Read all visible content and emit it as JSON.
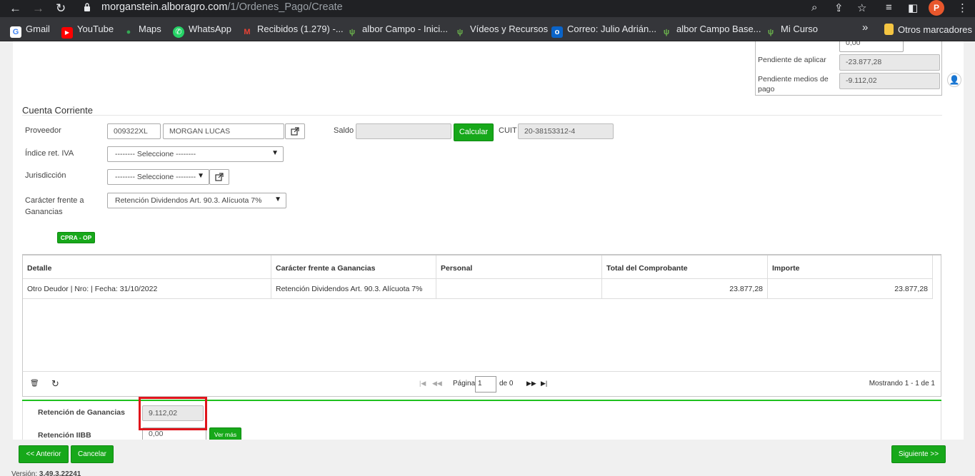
{
  "browser": {
    "url_host": "morganstein.alboragro.com",
    "url_path": "/1/Ordenes_Pago/Create",
    "profile_initial": "P",
    "bookmarks": [
      {
        "label": "Gmail",
        "icon": "G",
        "color": "#4285f4"
      },
      {
        "label": "YouTube",
        "icon": "▶",
        "color": "#ff0000"
      },
      {
        "label": "Maps",
        "icon": "●",
        "color": "#34a853"
      },
      {
        "label": "WhatsApp",
        "icon": "✆",
        "color": "#25d366"
      },
      {
        "label": "Recibidos (1.279) -...",
        "icon": "M",
        "color": "#ea4335"
      },
      {
        "label": "albor Campo - Inici...",
        "icon": "ψ",
        "color": "#6ab04c"
      },
      {
        "label": "Vídeos y Recursos",
        "icon": "ψ",
        "color": "#6ab04c"
      },
      {
        "label": "Correo: Julio Adrián...",
        "icon": "o",
        "color": "#0a64c9"
      },
      {
        "label": "albor Campo Base...",
        "icon": "ψ",
        "color": "#6ab04c"
      },
      {
        "label": "Mi Curso",
        "icon": "ψ",
        "color": "#6ab04c"
      }
    ],
    "more_bookmarks": "»",
    "other_bookmarks": "Otros marcadores"
  },
  "summary": {
    "partial_value": "0,00",
    "pendiente_aplicar_label": "Pendiente de aplicar",
    "pendiente_aplicar_value": "-23.877,28",
    "pendiente_medios_label": "Pendiente medios de pago",
    "pendiente_medios_value": "-9.112,02"
  },
  "form": {
    "section_title": "Cuenta Corriente",
    "proveedor_label": "Proveedor",
    "proveedor_code": "009322XL",
    "proveedor_name": "MORGAN LUCAS",
    "saldo_label": "Saldo",
    "saldo_value": "",
    "calcular_label": "Calcular",
    "cuit_label": "CUIT",
    "cuit_value": "20-38153312-4",
    "indice_label": "Índice ret. IVA",
    "indice_value": "-------- Seleccione --------",
    "jurisdiccion_label": "Jurisdicción",
    "jurisdiccion_value": "-------- Seleccione --------",
    "caracter_label_1": "Carácter frente a",
    "caracter_label_2": "Ganancias",
    "caracter_value": "Retención Dividendos Art. 90.3. Alícuota 7%",
    "cpra_label": "CPRA - OP"
  },
  "table": {
    "headers": [
      "Detalle",
      "Carácter frente a Ganancias",
      "Personal",
      "Total del Comprobante",
      "Importe"
    ],
    "rows": [
      [
        "Otro Deudor | Nro:  | Fecha: 31/10/2022",
        "Retención Dividendos Art. 90.3. Alícuota 7%",
        "",
        "23.877,28",
        "23.877,28"
      ]
    ]
  },
  "pager": {
    "page_label": "Página",
    "page_value": "1",
    "of_label": "de 0",
    "showing": "Mostrando 1 - 1 de 1"
  },
  "retenciones": {
    "ganancias_label": "Retención de Ganancias",
    "ganancias_value": "9.112,02",
    "iibb_label": "Retención IIBB",
    "iibb_value": "0,00",
    "ver_mas_label": "Ver más"
  },
  "footer": {
    "anterior_label": "<< Anterior",
    "cancelar_label": "Cancelar",
    "siguiente_label": "Siguiente >>",
    "version_label": "Versión:",
    "version_value": "3.49.3.22241"
  }
}
